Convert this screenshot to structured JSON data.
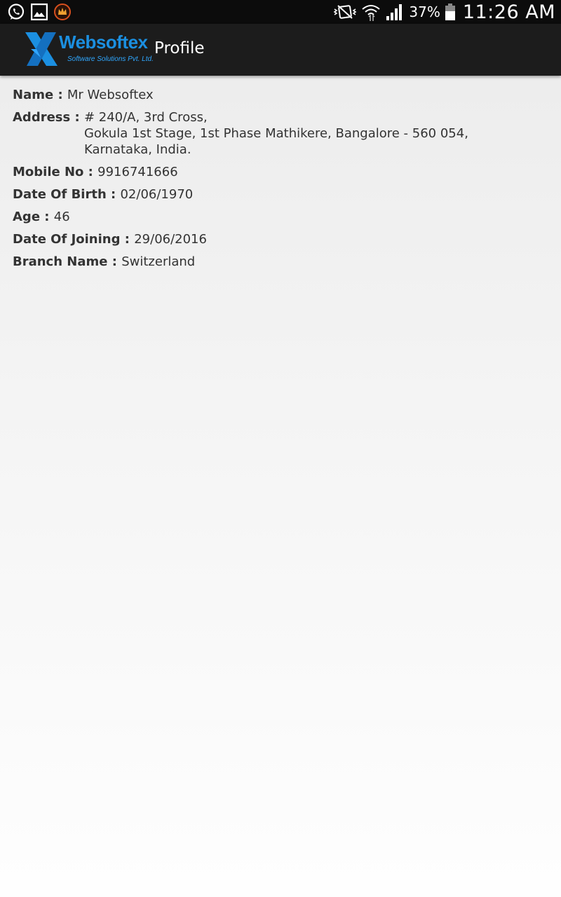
{
  "status_bar": {
    "battery_percent": "37%",
    "time": "11:26 AM",
    "left_icons": [
      "whatsapp-icon",
      "gallery-icon",
      "app-notification-icon"
    ],
    "right_icons": [
      "vibrate-icon",
      "wifi-icon",
      "signal-icon",
      "battery-icon"
    ]
  },
  "app_bar": {
    "logo": {
      "brand": "Websoftex",
      "tagline": "Software Solutions Pvt. Ltd."
    },
    "title": "Profile"
  },
  "profile": {
    "name": {
      "label": "Name : ",
      "value": "Mr Websoftex"
    },
    "address": {
      "label": "Address : ",
      "lines": [
        "# 240/A, 3rd Cross,",
        "Gokula 1st Stage, 1st Phase Mathikere, Bangalore - 560 054,",
        "Karnataka, India."
      ]
    },
    "mobile": {
      "label": "Mobile No : ",
      "value": "9916741666"
    },
    "dob": {
      "label": "Date Of Birth : ",
      "value": "02/06/1970"
    },
    "age": {
      "label": "Age : ",
      "value": "46"
    },
    "doj": {
      "label": "Date Of Joining : ",
      "value": "29/06/2016"
    },
    "branch": {
      "label": "Branch Name : ",
      "value": "Switzerland"
    }
  },
  "colors": {
    "status_bar": "#0c0c0c",
    "app_bar": "#1c1c1c",
    "brand_blue": "#1b8fe0",
    "text": "#333333"
  }
}
